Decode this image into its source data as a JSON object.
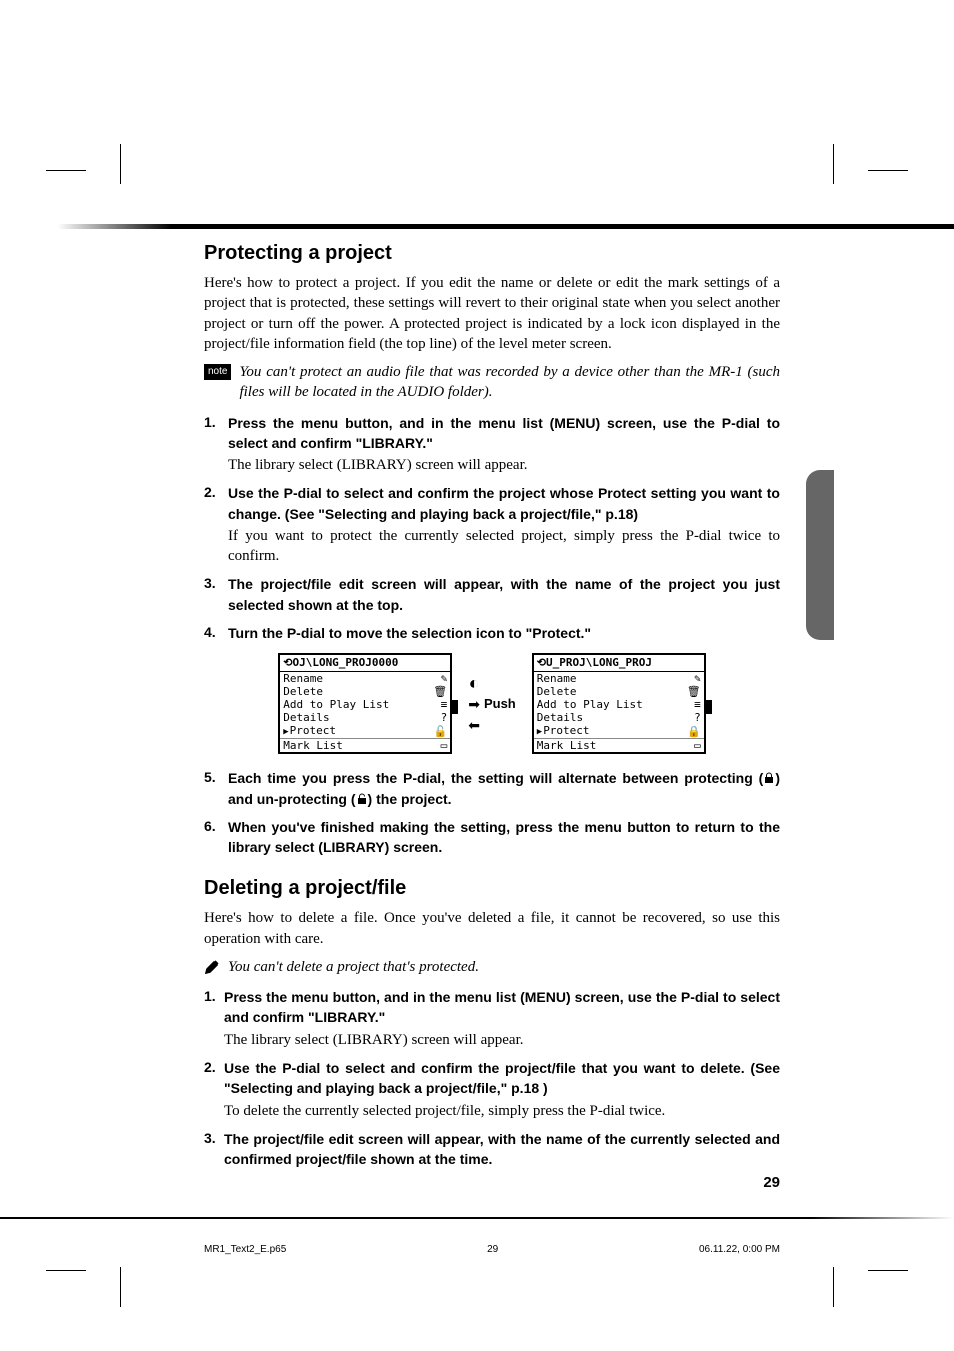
{
  "page_number": "29",
  "rule_color": "#000000",
  "section1": {
    "title": "Protecting a project",
    "intro": "Here's how to protect a project. If you edit the name or delete or edit the mark settings of a project that is protected, these settings will revert to their original state when you select another project or turn off the power. A protected project is indicated by a lock icon displayed in the project/file information field (the top line) of the level meter screen.",
    "note_badge": "note",
    "note": "You can't protect an audio file that was recorded by a device other than the MR-1 (such files will be located in the AUDIO folder).",
    "steps": [
      {
        "bold": "Press the menu button, and in the menu list (MENU) screen, use the P-dial to select and confirm \"LIBRARY.\"",
        "body": "The library select (LIBRARY) screen will appear."
      },
      {
        "bold": "Use the P-dial to select and confirm the project whose Protect setting you want to change. (See \"Selecting and playing back a project/file,\" p.18)",
        "body": "If you want to protect the currently selected project, simply press the P-dial twice to confirm."
      },
      {
        "bold": "The project/file edit screen will appear, with the name of the project you just selected shown at the top.",
        "body": ""
      },
      {
        "bold": "Turn the P-dial to move the selection icon to \"Protect.\"",
        "body": ""
      },
      {
        "bold_pre": "Each time you press the P-dial, the setting will alternate between protecting (",
        "bold_mid": ") and un-protecting (",
        "bold_post": ") the project.",
        "body": ""
      },
      {
        "bold": "When you've finished making the setting, press the menu button to return to the library select (LIBRARY) screen.",
        "body": ""
      }
    ]
  },
  "figure": {
    "push_label": "Push",
    "lcd_left": {
      "title": "⟲OJ\\LONG_PROJ0000",
      "rows": [
        {
          "label": "Rename",
          "icon": "✎"
        },
        {
          "label": "Delete",
          "icon": "🗑"
        },
        {
          "label": "Add to Play List",
          "icon": "≡"
        },
        {
          "label": "Details",
          "icon": "?"
        },
        {
          "label": "Protect",
          "icon": "🔓",
          "cursor": true
        },
        {
          "label": "Mark List",
          "icon": "▭"
        }
      ]
    },
    "lcd_right": {
      "title": "⟲U_PROJ\\LONG_PROJ",
      "rows": [
        {
          "label": "Rename",
          "icon": "✎"
        },
        {
          "label": "Delete",
          "icon": "🗑"
        },
        {
          "label": "Add to Play List",
          "icon": "≡"
        },
        {
          "label": "Details",
          "icon": "?"
        },
        {
          "label": "Protect",
          "icon": "🔒",
          "cursor": true
        },
        {
          "label": "Mark List",
          "icon": "▭"
        }
      ]
    }
  },
  "section2": {
    "title": "Deleting a project/file",
    "intro": "Here's how to delete a file. Once you've deleted a file, it cannot be recovered, so use this operation with care.",
    "note": "You can't delete a project that's protected.",
    "steps": [
      {
        "bold": "Press the menu button, and in the menu list (MENU) screen, use the P-dial to select and confirm \"LIBRARY.\"",
        "body": "The library select (LIBRARY) screen will appear."
      },
      {
        "bold": "Use the P-dial to select and confirm the project/file that you want to delete. (See \"Selecting and playing back a project/file,\" p.18 )",
        "body": "To delete the currently selected project/file, simply press the P-dial twice."
      },
      {
        "bold": "The project/file edit screen will appear, with the name of the currently selected and confirmed project/file shown at the time.",
        "body": ""
      }
    ]
  },
  "footer": {
    "file": "MR1_Text2_E.p65",
    "page": "29",
    "timestamp": "06.11.22, 0:00 PM"
  }
}
